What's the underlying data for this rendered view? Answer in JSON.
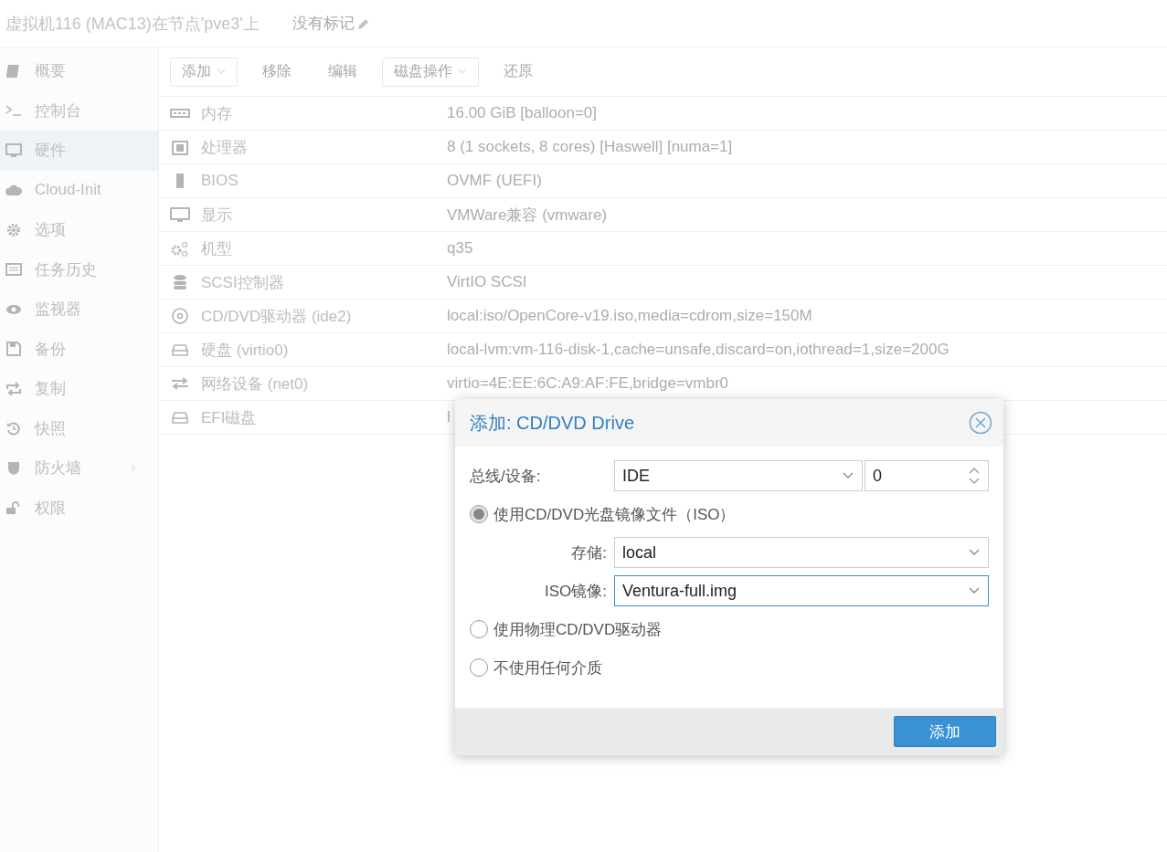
{
  "header": {
    "title": "虚拟机116 (MAC13)在节点'pve3'上",
    "tags": "没有标记"
  },
  "sidebar": {
    "items": [
      {
        "label": "概要",
        "selected": false
      },
      {
        "label": "控制台",
        "selected": false
      },
      {
        "label": "硬件",
        "selected": true
      },
      {
        "label": "Cloud-Init",
        "selected": false
      },
      {
        "label": "选项",
        "selected": false
      },
      {
        "label": "任务历史",
        "selected": false
      },
      {
        "label": "监视器",
        "selected": false
      },
      {
        "label": "备份",
        "selected": false
      },
      {
        "label": "复制",
        "selected": false
      },
      {
        "label": "快照",
        "selected": false
      },
      {
        "label": "防火墙",
        "selected": false,
        "expandable": true
      },
      {
        "label": "权限",
        "selected": false
      }
    ]
  },
  "toolbar": [
    {
      "label": "添加",
      "dropdown": true
    },
    {
      "label": "移除",
      "dropdown": false
    },
    {
      "label": "编辑",
      "dropdown": false
    },
    {
      "label": "磁盘操作",
      "dropdown": true
    },
    {
      "label": "还原",
      "dropdown": false
    }
  ],
  "table": {
    "rows": [
      {
        "name": "内存",
        "value": "16.00 GiB [balloon=0]"
      },
      {
        "name": "处理器",
        "value": "8 (1 sockets, 8 cores) [Haswell] [numa=1]"
      },
      {
        "name": "BIOS",
        "value": "OVMF (UEFI)"
      },
      {
        "name": "显示",
        "value": "VMWare兼容 (vmware)"
      },
      {
        "name": "机型",
        "value": "q35"
      },
      {
        "name": "SCSI控制器",
        "value": "VirtIO SCSI"
      },
      {
        "name": "CD/DVD驱动器 (ide2)",
        "value": "local:iso/OpenCore-v19.iso,media=cdrom,size=150M"
      },
      {
        "name": "硬盘 (virtio0)",
        "value": "local-lvm:vm-116-disk-1,cache=unsafe,discard=on,iothread=1,size=200G"
      },
      {
        "name": "网络设备 (net0)",
        "value": "virtio=4E:EE:6C:A9:AF:FE,bridge=vmbr0"
      },
      {
        "name": "EFI磁盘",
        "value": "l"
      }
    ]
  },
  "dialog": {
    "title": "添加: CD/DVD Drive",
    "bus": {
      "label": "总线/设备:",
      "value": "IDE",
      "device": "0"
    },
    "options": [
      {
        "label": "使用CD/DVD光盘镜像文件（ISO）",
        "selected": true,
        "fields": [
          {
            "label": "存储:",
            "value": "local",
            "focused": false
          },
          {
            "label": "ISO镜像:",
            "value": "Ventura-full.img",
            "focused": true
          }
        ]
      },
      {
        "label": "使用物理CD/DVD驱动器",
        "selected": false
      },
      {
        "label": "不使用任何介质",
        "selected": false
      }
    ],
    "button": "添加"
  }
}
